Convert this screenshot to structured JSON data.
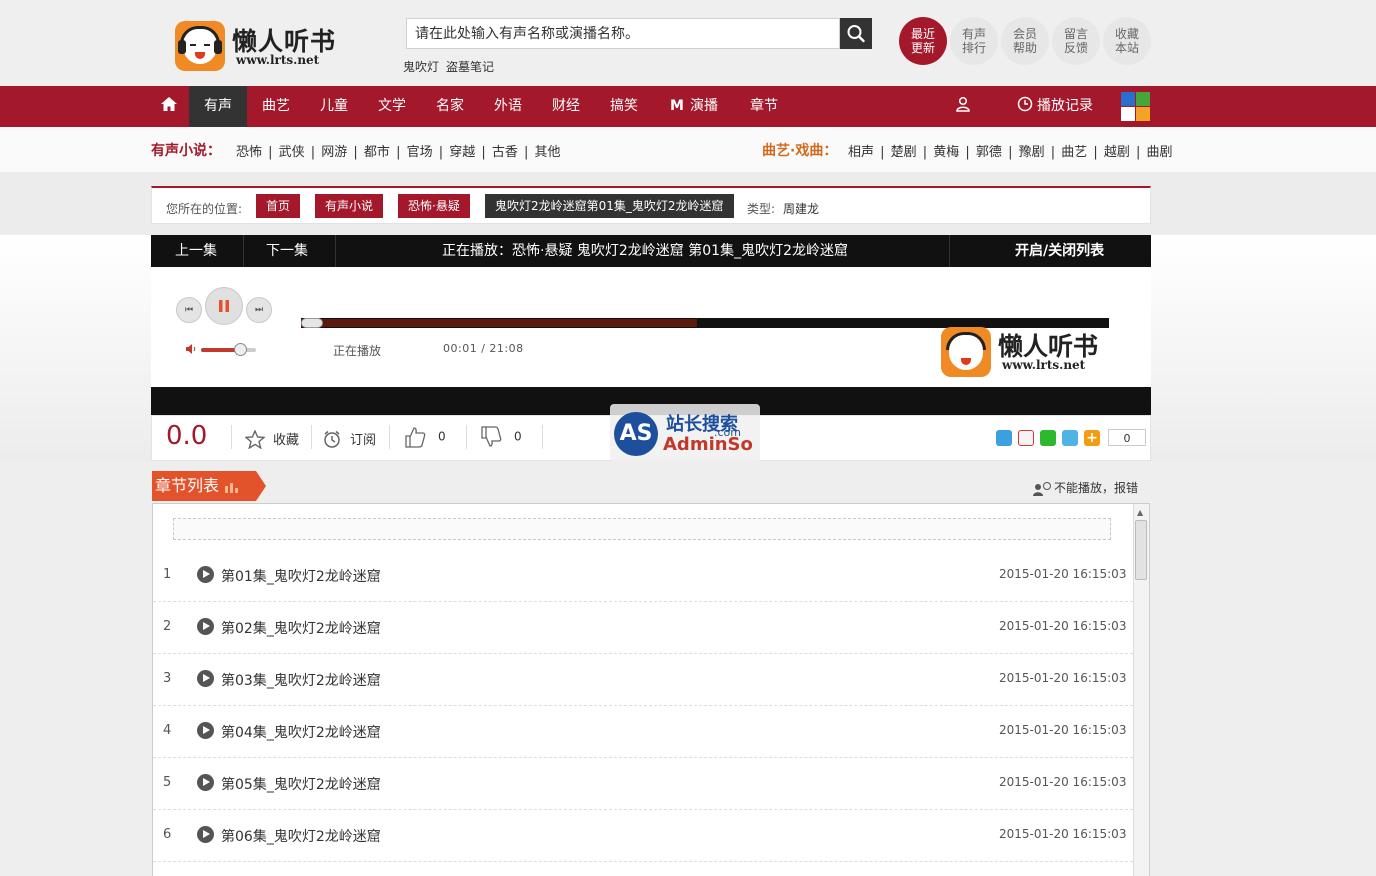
{
  "header": {
    "logo_title": "懒人听书",
    "logo_url": "www.lrts.net",
    "search_placeholder": "请在此处输入有声名称或演播名称。",
    "hot_searches": [
      "鬼吹灯",
      "盗墓笔记"
    ],
    "shortcuts": [
      {
        "line1": "最近",
        "line2": "更新",
        "active": true
      },
      {
        "line1": "有声",
        "line2": "排行",
        "active": false
      },
      {
        "line1": "会员",
        "line2": "帮助",
        "active": false
      },
      {
        "line1": "留言",
        "line2": "反馈",
        "active": false
      },
      {
        "line1": "收藏",
        "line2": "本站",
        "active": false
      }
    ]
  },
  "nav": {
    "items": [
      "有声",
      "曲艺",
      "儿童",
      "文学",
      "名家",
      "外语",
      "财经",
      "搞笑",
      "演播",
      "章节"
    ],
    "active_index": 0,
    "live_prefix": "M",
    "history_label": "播放记录"
  },
  "subcats": {
    "novel_label": "有声小说：",
    "novel_links": "恐怖 | 武侠 | 网游 | 都市 | 官场 | 穿越 | 古香 | 其他",
    "opera_label": "曲艺·戏曲：",
    "opera_links": "相声 | 楚剧 | 黄梅 | 郭德 | 豫剧 | 曲艺 | 越剧 | 曲剧"
  },
  "breadcrumb": {
    "label": "您所在的位置:",
    "items": [
      "首页",
      "有声小说",
      "恐怖·悬疑"
    ],
    "current": "鬼吹灯2龙岭迷窟第01集_鬼吹灯2龙岭迷窟",
    "type_label": "类型:",
    "type_value": "周建龙"
  },
  "player": {
    "prev_label": "上一集",
    "next_label": "下一集",
    "now_playing": "正在播放：恐怖·悬疑 鬼吹灯2龙岭迷窟 第01集_鬼吹灯2龙岭迷窟",
    "toggle_list_label": "开启/关闭列表",
    "status": "正在播放",
    "time": "00:01 / 21:08",
    "progress_fraction": 0.49,
    "volume_fraction": 0.7
  },
  "actions": {
    "score": "0.0",
    "favorite_label": "收藏",
    "subscribe_label": "订阅",
    "like_count": "0",
    "dislike_count": "0",
    "share_count": "0"
  },
  "watermark": {
    "line1": "站长搜索",
    "line2": "AdminSo",
    "small": ".com"
  },
  "chapters": {
    "title": "章节列表",
    "report_label": "不能播放，报错",
    "rows": [
      {
        "num": "1",
        "title": "第01集_鬼吹灯2龙岭迷窟",
        "date": "2015-01-20 16:15:03"
      },
      {
        "num": "2",
        "title": "第02集_鬼吹灯2龙岭迷窟",
        "date": "2015-01-20 16:15:03"
      },
      {
        "num": "3",
        "title": "第03集_鬼吹灯2龙岭迷窟",
        "date": "2015-01-20 16:15:03"
      },
      {
        "num": "4",
        "title": "第04集_鬼吹灯2龙岭迷窟",
        "date": "2015-01-20 16:15:03"
      },
      {
        "num": "5",
        "title": "第05集_鬼吹灯2龙岭迷窟",
        "date": "2015-01-20 16:15:03"
      },
      {
        "num": "6",
        "title": "第06集_鬼吹灯2龙岭迷窟",
        "date": "2015-01-20 16:15:03"
      }
    ]
  },
  "colors": {
    "brand_red": "#a3192b",
    "dark": "#111111",
    "tab_orange": "#e2532c"
  }
}
